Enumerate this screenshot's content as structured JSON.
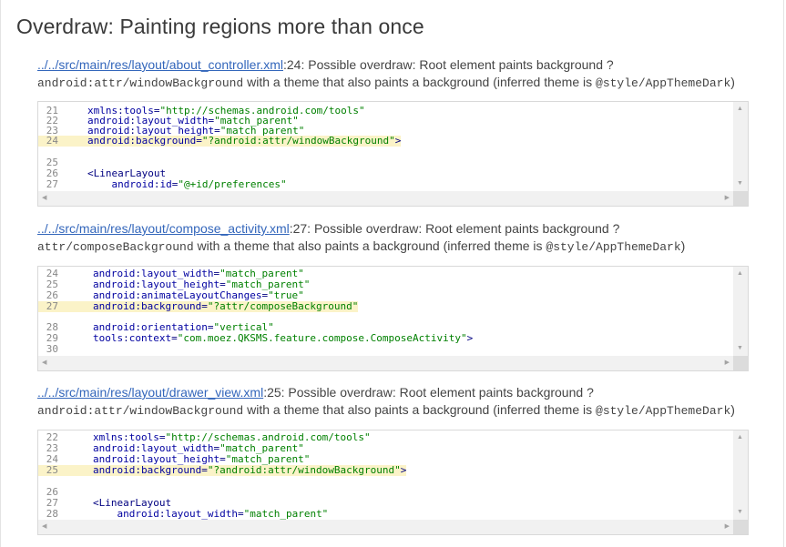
{
  "title": "Overdraw: Painting regions more than once",
  "issues": [
    {
      "link": "../../src/main/res/layout/about_controller.xml",
      "line_ref": ":24: Possible overdraw: Root element paints background ",
      "attr": "?android:attr/windowBackground",
      "attr_display": "android:attr/windowBackground",
      "mid": " with a theme that also paints a background (inferred theme is ",
      "theme": "@style/AppThemeDark",
      "end": ")",
      "code": [
        {
          "n": "21",
          "t": "xmlns:tools=\"http://schemas.android.com/tools\""
        },
        {
          "n": "22",
          "t": "android:layout_width=\"match_parent\""
        },
        {
          "n": "23",
          "t": "android:layout_height=\"match_parent\""
        },
        {
          "n": "24",
          "t": "android:background=\"?android:attr/windowBackground\">"
        },
        {
          "n": "25",
          "t": ""
        },
        {
          "n": "26",
          "t": "<LinearLayout"
        },
        {
          "n": "27",
          "t": "    android:id=\"@+id/preferences\""
        }
      ]
    },
    {
      "link": "../../src/main/res/layout/compose_activity.xml",
      "line_ref": ":27: Possible overdraw: Root element paints background ",
      "attr": "?attr/composeBackground",
      "attr_display": "attr/composeBackground",
      "mid": " with a theme that also paints a background (inferred theme is ",
      "theme": "@style/AppThemeDark",
      "end": ")",
      "code": [
        {
          "n": "24",
          "t": "android:layout_width=\"match_parent\""
        },
        {
          "n": "25",
          "t": "android:layout_height=\"match_parent\""
        },
        {
          "n": "26",
          "t": "android:animateLayoutChanges=\"true\""
        },
        {
          "n": "27",
          "t": "android:background=\"?attr/composeBackground\""
        },
        {
          "n": "28",
          "t": "android:orientation=\"vertical\""
        },
        {
          "n": "29",
          "t": "tools:context=\"com.moez.QKSMS.feature.compose.ComposeActivity\">"
        },
        {
          "n": "30",
          "t": ""
        }
      ]
    },
    {
      "link": "../../src/main/res/layout/drawer_view.xml",
      "line_ref": ":25: Possible overdraw: Root element paints background ",
      "attr": "?android:attr/windowBackground",
      "attr_display": "android:attr/windowBackground",
      "mid": " with a theme that also paints a background (inferred theme is ",
      "theme": "@style/AppThemeDark",
      "end": ")",
      "code": [
        {
          "n": "22",
          "t": "xmlns:tools=\"http://schemas.android.com/tools\""
        },
        {
          "n": "23",
          "t": "android:layout_width=\"match_parent\""
        },
        {
          "n": "24",
          "t": "android:layout_height=\"match_parent\""
        },
        {
          "n": "25",
          "t": "android:background=\"?android:attr/windowBackground\">"
        },
        {
          "n": "26",
          "t": ""
        },
        {
          "n": "27",
          "t": "<LinearLayout"
        },
        {
          "n": "28",
          "t": "    android:layout_width=\"match_parent\""
        }
      ]
    }
  ]
}
